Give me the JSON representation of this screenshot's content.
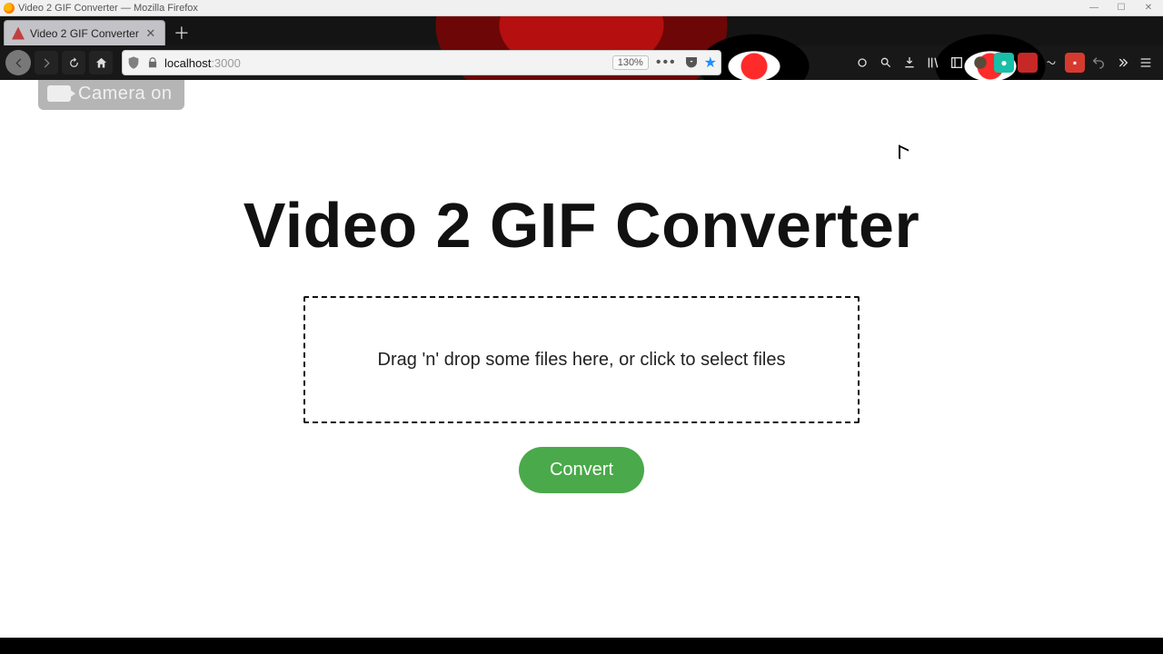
{
  "window": {
    "title": "Video 2 GIF Converter — Mozilla Firefox"
  },
  "tab": {
    "title": "Video 2 GIF Converter"
  },
  "url": {
    "host": "localhost",
    "port": ":3000",
    "zoom": "130%"
  },
  "overlay": {
    "camera": "Camera on"
  },
  "app": {
    "heading": "Video 2 GIF Converter",
    "dropzone_text": "Drag 'n' drop some files here, or click to select files",
    "convert_label": "Convert"
  }
}
